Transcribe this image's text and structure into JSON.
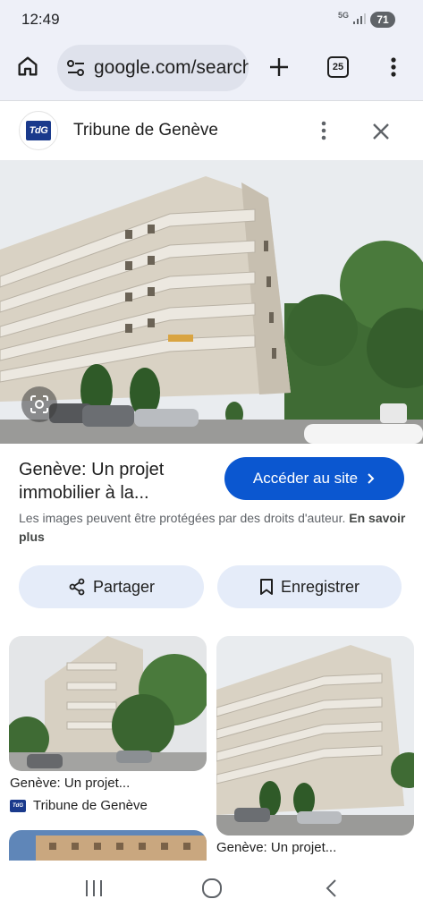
{
  "status_bar": {
    "time": "12:49",
    "network": "5G",
    "battery": "71"
  },
  "browser": {
    "url": "google.com/search",
    "tab_count": "25",
    "icons": [
      "home-icon",
      "tune-icon",
      "plus-icon",
      "tabs-icon",
      "more-vert-icon"
    ]
  },
  "source": {
    "logo_text": "TdG",
    "name": "Tribune de Genève"
  },
  "result": {
    "title_line1": "Genève: Un projet",
    "title_line2": "immobilier à la...",
    "visit_label": "Accéder au site",
    "copyright_text": "Les images peuvent être protégées par des droits d'auteur.",
    "learn_more": "En savoir plus"
  },
  "actions": {
    "share_label": "Partager",
    "save_label": "Enregistrer"
  },
  "related": [
    {
      "caption": "Genève: Un projet...",
      "source": "Tribune de Genève"
    },
    {
      "caption": "Genève: Un projet..."
    }
  ],
  "colors": {
    "accent": "#0b57d0",
    "chrome_bg": "#eef0f8",
    "action_bg": "#e5ecf9"
  }
}
